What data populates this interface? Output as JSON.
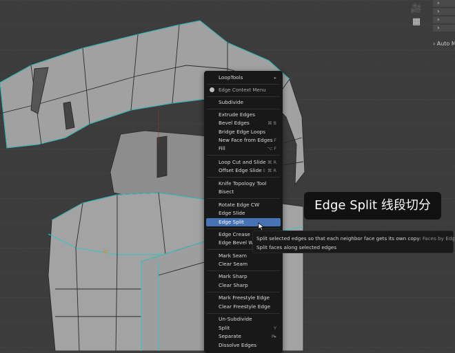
{
  "app": {
    "mode_label": "Auto M"
  },
  "icons": {
    "camera": "camera-icon",
    "grid": "grid-icon",
    "cursor": "mouse-cursor-icon"
  },
  "caption": {
    "text": "Edge Split 线段切分"
  },
  "context_menu": {
    "header": "Edge Context Menu",
    "items": [
      {
        "label": "LoopTools",
        "shortcut": "▸"
      },
      {
        "label": "Subdivide",
        "shortcut": ""
      },
      {
        "label": "Extrude Edges",
        "shortcut": ""
      },
      {
        "label": "Bevel Edges",
        "shortcut": "⌘ B"
      },
      {
        "label": "Bridge Edge Loops",
        "shortcut": ""
      },
      {
        "label": "New Face from Edges",
        "shortcut": "F"
      },
      {
        "label": "Fill",
        "shortcut": "⌥ F"
      },
      {
        "label": "Loop Cut and Slide",
        "shortcut": "⌘ R"
      },
      {
        "label": "Offset Edge Slide",
        "shortcut": "⇧ ⌘ R"
      },
      {
        "label": "Knife Topology Tool",
        "shortcut": ""
      },
      {
        "label": "Bisect",
        "shortcut": ""
      },
      {
        "label": "Rotate Edge CW",
        "shortcut": ""
      },
      {
        "label": "Edge Slide",
        "shortcut": ""
      },
      {
        "label": "Edge Split",
        "shortcut": ""
      },
      {
        "label": "Edge Crease",
        "shortcut": ""
      },
      {
        "label": "Edge Bevel W",
        "shortcut": ""
      },
      {
        "label": "Mark Seam",
        "shortcut": ""
      },
      {
        "label": "Clear Seam",
        "shortcut": ""
      },
      {
        "label": "Mark Sharp",
        "shortcut": ""
      },
      {
        "label": "Clear Sharp",
        "shortcut": ""
      },
      {
        "label": "Mark Freestyle Edge",
        "shortcut": ""
      },
      {
        "label": "Clear Freestyle Edge",
        "shortcut": ""
      },
      {
        "label": "Un-Subdivide",
        "shortcut": ""
      },
      {
        "label": "Split",
        "shortcut": "Y"
      },
      {
        "label": "Separate",
        "shortcut": "P▸"
      },
      {
        "label": "Dissolve Edges",
        "shortcut": ""
      }
    ]
  },
  "tooltip": {
    "line1": "Split selected edges so that each neighbor face gets its own copy:",
    "line1_value": "Faces by Edges",
    "line2": "Split faces along selected edges"
  }
}
